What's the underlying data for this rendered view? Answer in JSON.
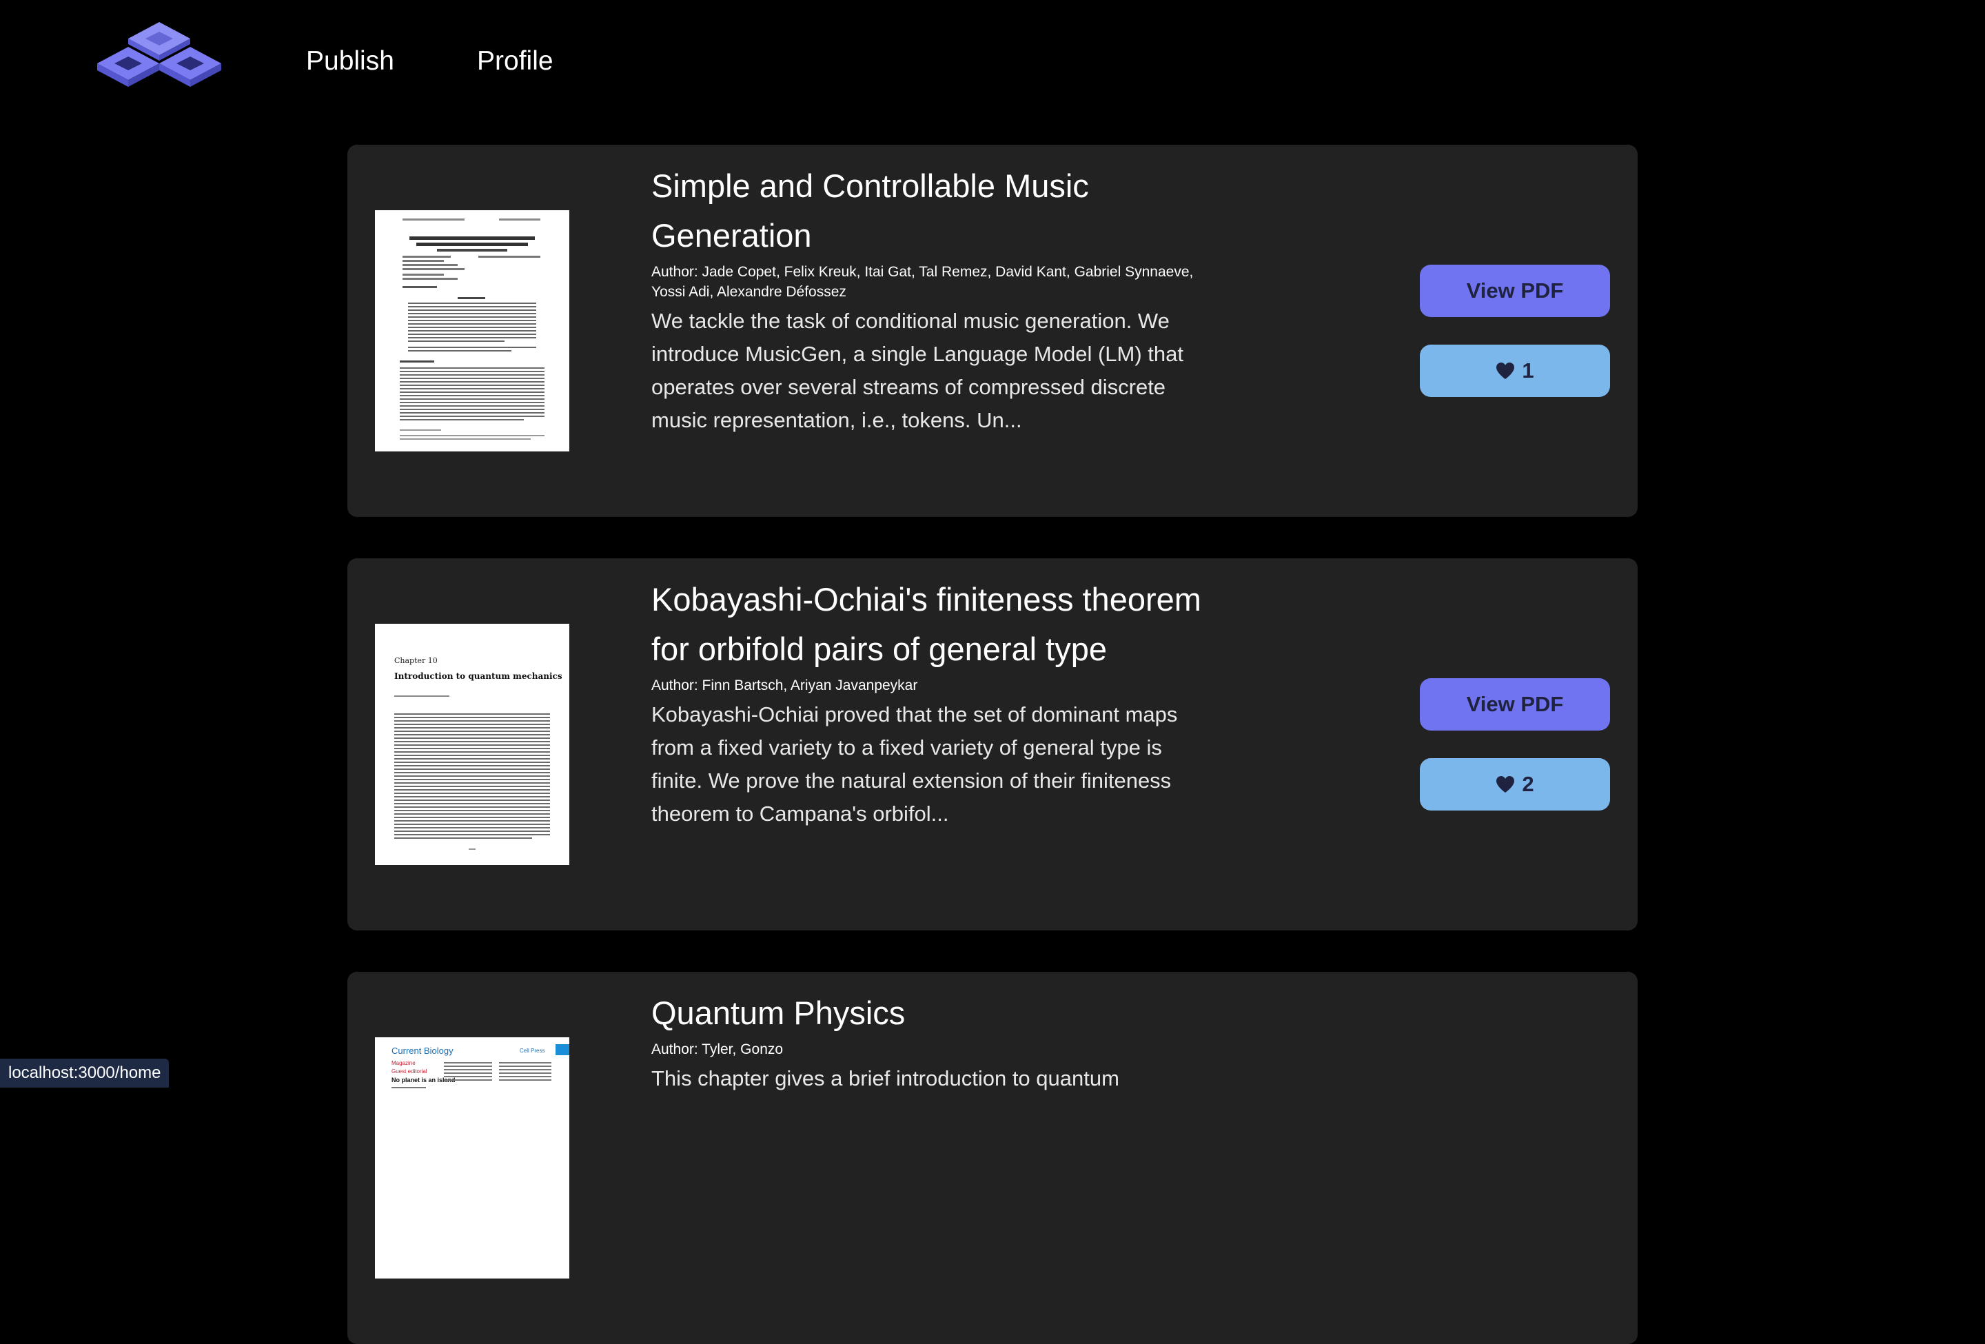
{
  "nav": {
    "logo_icon": "cubes-logo-icon",
    "publish_label": "Publish",
    "profile_label": "Profile"
  },
  "colors": {
    "background": "#000000",
    "card": "#222222",
    "view_pdf_button": "#7174f1",
    "like_button": "#7cb7ec",
    "logo_primary": "#6f6ff0",
    "logo_secondary": "#8d8ff5"
  },
  "papers": [
    {
      "title": "Simple and Controllable Music Generation",
      "authors": "Author: Jade Copet, Felix Kreuk, Itai Gat, Tal Remez, David Kant, Gabriel Synnaeve, Yossi Adi, Alexandre Défossez",
      "abstract": "We tackle the task of conditional music generation. We introduce MusicGen, a single Language Model (LM) that operates over several streams of compressed discrete music representation, i.e., tokens. Un...",
      "view_pdf_label": "View PDF",
      "likes": "1",
      "like_icon": "heart-icon",
      "thumbnail": "paper-thumbnail"
    },
    {
      "title": "Kobayashi-Ochiai's finiteness theorem for orbifold pairs of general type",
      "authors": "Author: Finn Bartsch, Ariyan Javanpeykar",
      "abstract": "Kobayashi-Ochiai proved that the set of dominant maps from a fixed variety to a fixed variety of general type is finite. We prove the natural extension of their finiteness theorem to Campana's orbifol...",
      "view_pdf_label": "View PDF",
      "likes": "2",
      "like_icon": "heart-icon",
      "thumbnail": "paper-thumbnail",
      "thumb_heading_1": "Chapter 10",
      "thumb_heading_2": "Introduction to quantum mechanics"
    },
    {
      "title": "Quantum Physics",
      "authors": "Author: Tyler, Gonzo",
      "abstract": "This chapter gives a brief introduction to quantum",
      "thumbnail": "paper-thumbnail",
      "thumb_journal": "Current Biology",
      "thumb_publisher": "Cell Press",
      "thumb_section": "Magazine",
      "thumb_subsection": "Guest editorial",
      "thumb_headline": "No planet is an island"
    }
  ],
  "status_bar": {
    "url": "localhost:3000/home"
  }
}
